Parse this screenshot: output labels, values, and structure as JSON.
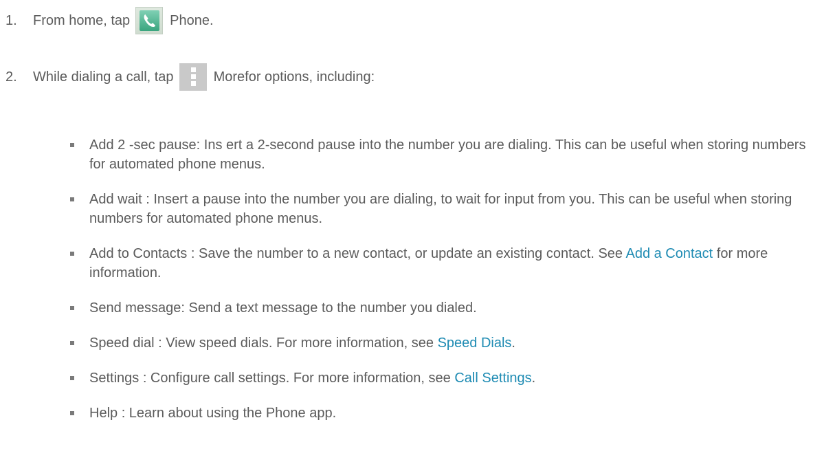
{
  "steps": [
    {
      "number": "1.",
      "before_icon": "From home, tap",
      "icon": "phone-app-icon",
      "after_icon": "Phone",
      "end": " ."
    },
    {
      "number": "2.",
      "before_icon": "While dialing a call, tap",
      "icon": "more-options-icon",
      "after_icon": "More",
      "end": " for options, including:"
    }
  ],
  "options": [
    {
      "text": "Add 2 -sec pause: Ins ert a 2-second pause into the number you are dialing. This can be useful when storing numbers for automated phone menus."
    },
    {
      "text": "Add wait : Insert a pause into the number you are dialing, to wait for input from you. This can be useful when storing numbers for automated phone menus."
    },
    {
      "prefix": "Add to Contacts  : Save the number to a new contact, or update an existing contact. See ",
      "link": "Add a Contact",
      "suffix": " for more information."
    },
    {
      "text": "Send message:  Send a text message to the number you dialed."
    },
    {
      "prefix": "Speed dial : View speed dials. For more information, see ",
      "link": "Speed Dials",
      "suffix": "."
    },
    {
      "prefix": "Settings : Configure call settings. For more information, see ",
      "link": "Call Settings",
      "suffix": "."
    },
    {
      "text": "Help : Learn about using the Phone app."
    }
  ],
  "colors": {
    "text": "#5b5b5b",
    "link": "#1e8bb3",
    "bullet": "#7a7a7a"
  }
}
